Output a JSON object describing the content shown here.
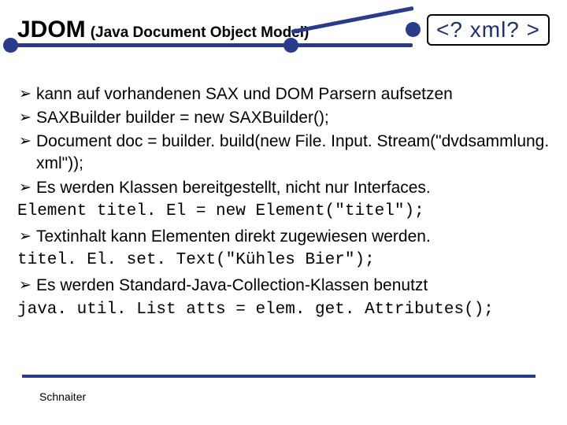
{
  "header": {
    "title_main": "JDOM",
    "title_sub": "(Java Document Object Model)",
    "badge": "<? xml? >"
  },
  "bullets": [
    {
      "text": "kann auf vorhandenen SAX und DOM Parsern aufsetzen"
    },
    {
      "text": "SAXBuilder builder = new SAXBuilder();"
    },
    {
      "text": "Document doc = builder. build(new File. Input. Stream(\"dvdsammlung. xml\"));"
    },
    {
      "text": "Es werden Klassen bereitgestellt, nicht nur Interfaces."
    }
  ],
  "code1": "Element titel. El = new Element(\"titel\");",
  "bullet5": "Textinhalt kann Elementen direkt zugewiesen werden.",
  "code2": "titel. El. set. Text(\"Kühles Bier\");",
  "bullet6": "Es werden Standard-Java-Collection-Klassen benutzt",
  "code3": "java. util. List atts = elem. get. Attributes();",
  "footer": "Schnaiter",
  "arrow_glyph": "➢"
}
